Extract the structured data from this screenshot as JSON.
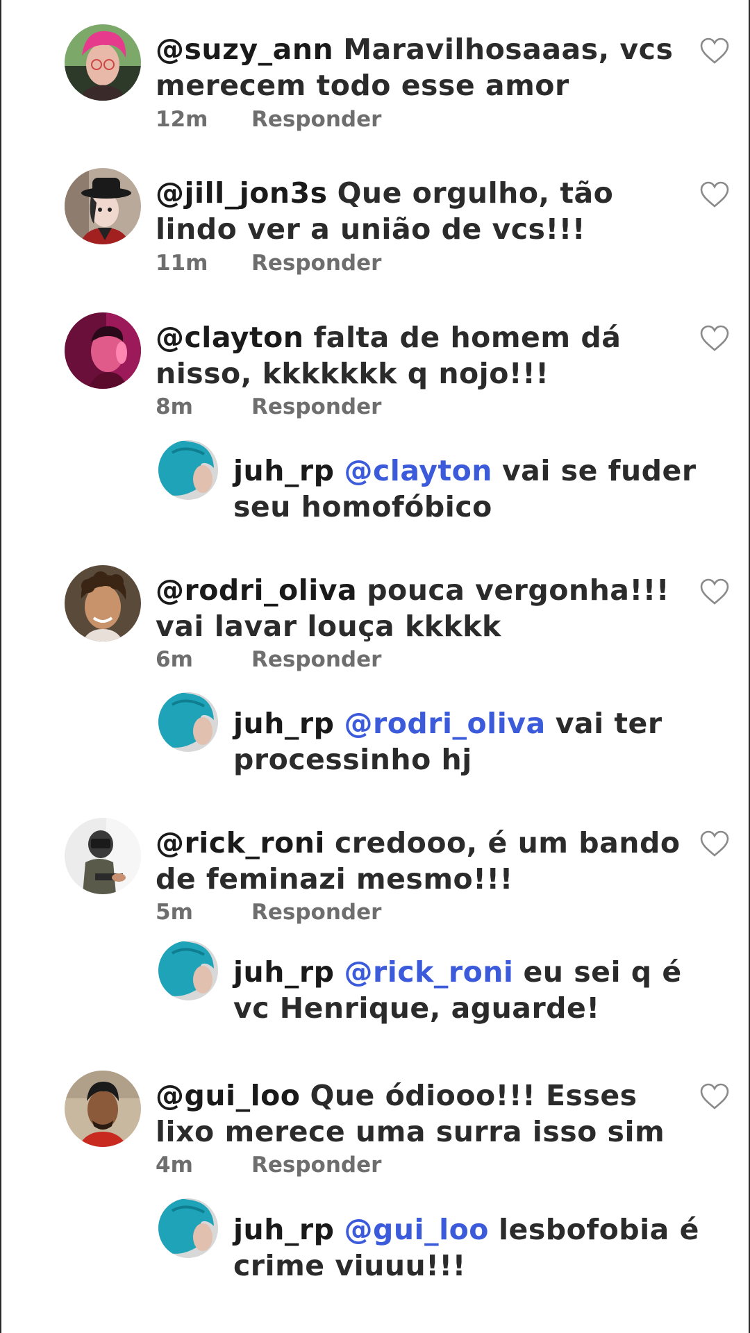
{
  "comments": [
    {
      "username": "@suzy_ann",
      "text": "Maravilhosaaas, vcs merecem todo esse amor",
      "time": "12m",
      "reply_label": "Responder",
      "avatar": "pink-haired-person-avatar"
    },
    {
      "username": "@jill_jon3s",
      "text": "Que orgulho, tão lindo ver a união de vcs!!!",
      "time": "11m",
      "reply_label": "Responder",
      "avatar": "person-with-black-hat-avatar"
    },
    {
      "username": "@clayton",
      "text": "falta de homem dá nisso, kkkkkkk q nojo!!!",
      "time": "8m",
      "reply_label": "Responder",
      "avatar": "man-in-magenta-light-avatar",
      "reply": {
        "username": "juh_rp",
        "mention": "@clayton",
        "text": "vai se fuder seu homofóbico",
        "avatar": "blue-haired-person-avatar"
      }
    },
    {
      "username": "@rodri_oliva",
      "text": "pouca vergonha!!! vai lavar louça kkkkk",
      "time": "6m",
      "reply_label": "Responder",
      "avatar": "curly-haired-man-avatar",
      "reply": {
        "username": "juh_rp",
        "mention": "@rodri_oliva",
        "text": "vai ter processinho hj",
        "avatar": "blue-haired-person-avatar"
      }
    },
    {
      "username": "@rick_roni",
      "text": "credooo, é um bando de feminazi mesmo!!!",
      "time": "5m",
      "reply_label": "Responder",
      "avatar": "man-with-welding-mask-avatar",
      "reply": {
        "username": "juh_rp",
        "mention": "@rick_roni",
        "text": "eu sei q é vc Henrique, aguarde!",
        "avatar": "blue-haired-person-avatar"
      }
    },
    {
      "username": "@gui_loo",
      "text": "Que ódiooo!!! Esses lixo merece uma surra isso sim",
      "time": "4m",
      "reply_label": "Responder",
      "avatar": "man-in-red-shirt-avatar",
      "reply": {
        "username": "juh_rp",
        "mention": "@gui_loo",
        "text": "lesbofobia é crime viuuu!!!",
        "avatar": "blue-haired-person-avatar"
      }
    }
  ],
  "colors": {
    "mention": "#3b5bdb",
    "text": "#2b2b2b",
    "meta": "#6e6e6e",
    "heart_stroke": "#8a8a8a"
  },
  "icons": {
    "like": "heart-outline-icon"
  }
}
